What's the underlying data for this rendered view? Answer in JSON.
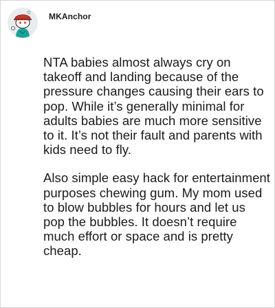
{
  "comment": {
    "username": "MKAnchor",
    "avatar_icon": "snoo-avatar-icon",
    "paragraphs": [
      "NTA babies almost always cry on takeoff and landing because of the pressure changes causing their ears to pop. While it’s generally minimal for adults babies are much more sensitive to it. It’s not their fault and parents with kids need to fly.",
      "Also simple easy hack for entertainment purposes chewing gum. My mom used to blow bubbles for hours and let us pop the bubbles. It doesn’t require much effort or space and is pretty cheap."
    ]
  },
  "colors": {
    "text": "#1a1a1b",
    "border": "#d6d6d6",
    "hat_red": "#c0392b",
    "shirt_teal": "#1aa39a"
  }
}
